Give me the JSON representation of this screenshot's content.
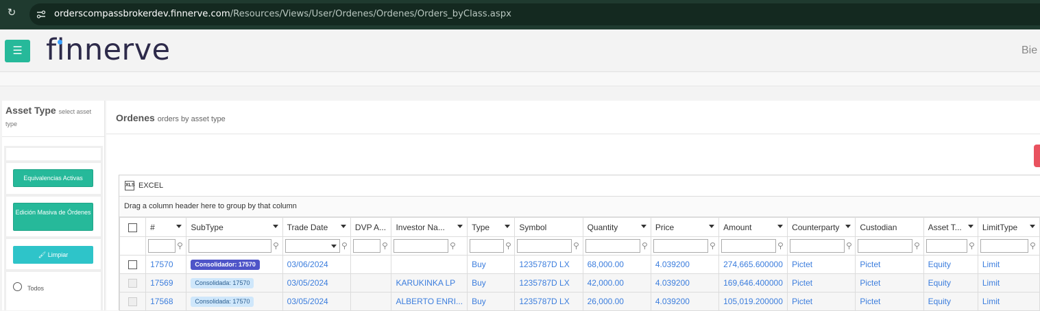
{
  "browser": {
    "url_host": "orderscompassbrokerdev.finnerve.com",
    "url_path": "/Resources/Views/User/Ordenes/Ordenes/Orders_byClass.aspx"
  },
  "header": {
    "logo_text": "finnerve",
    "user_text": "Bie"
  },
  "left": {
    "title": "Asset Type",
    "subtitle": "select asset type",
    "btn_equivalencias": "Equivalencias Activas",
    "btn_edicion": "Edición Masiva de Órdenes",
    "btn_limpiar": "Limpiar",
    "radio_todos": "Todos"
  },
  "main": {
    "title": "Ordenes",
    "subtitle": "orders by asset type",
    "excel_label": "EXCEL",
    "group_hint": "Drag a column header here to group by that column"
  },
  "grid": {
    "columns": [
      "#",
      "SubType",
      "Trade Date",
      "DVP A...",
      "Investor Na...",
      "Type",
      "Symbol",
      "Quantity",
      "Price",
      "Amount",
      "Counterparty",
      "Custodian",
      "Asset T...",
      "LimitType"
    ],
    "rows": [
      {
        "id": "17570",
        "subtype": "Consolidador: 17570",
        "subtype_style": "dark",
        "date": "03/06/2024",
        "dvp": "",
        "investor": "",
        "type": "Buy",
        "symbol": "1235787D LX",
        "quantity": "68,000.00",
        "price": "4.039200",
        "amount": "274,665.600000",
        "counterparty": "Pictet",
        "custodian": "Pictet",
        "asset": "Equity",
        "limit": "Limit"
      },
      {
        "id": "17569",
        "subtype": "Consolidada: 17570",
        "subtype_style": "light",
        "date": "03/05/2024",
        "dvp": "",
        "investor": "KARUKINKA LP",
        "type": "Buy",
        "symbol": "1235787D LX",
        "quantity": "42,000.00",
        "price": "4.039200",
        "amount": "169,646.400000",
        "counterparty": "Pictet",
        "custodian": "Pictet",
        "asset": "Equity",
        "limit": "Limit"
      },
      {
        "id": "17568",
        "subtype": "Consolidada: 17570",
        "subtype_style": "light",
        "date": "03/05/2024",
        "dvp": "",
        "investor": "ALBERTO ENRI...",
        "type": "Buy",
        "symbol": "1235787D LX",
        "quantity": "26,000.00",
        "price": "4.039200",
        "amount": "105,019.200000",
        "counterparty": "Pictet",
        "custodian": "Pictet",
        "asset": "Equity",
        "limit": "Limit"
      }
    ]
  },
  "colors": {
    "accent": "#26b99a",
    "cyan": "#2ec4c9",
    "link": "#3b7ddd",
    "badge_dark": "#4e54c8",
    "badge_light": "#cfe7fb",
    "danger": "#e9525f"
  }
}
